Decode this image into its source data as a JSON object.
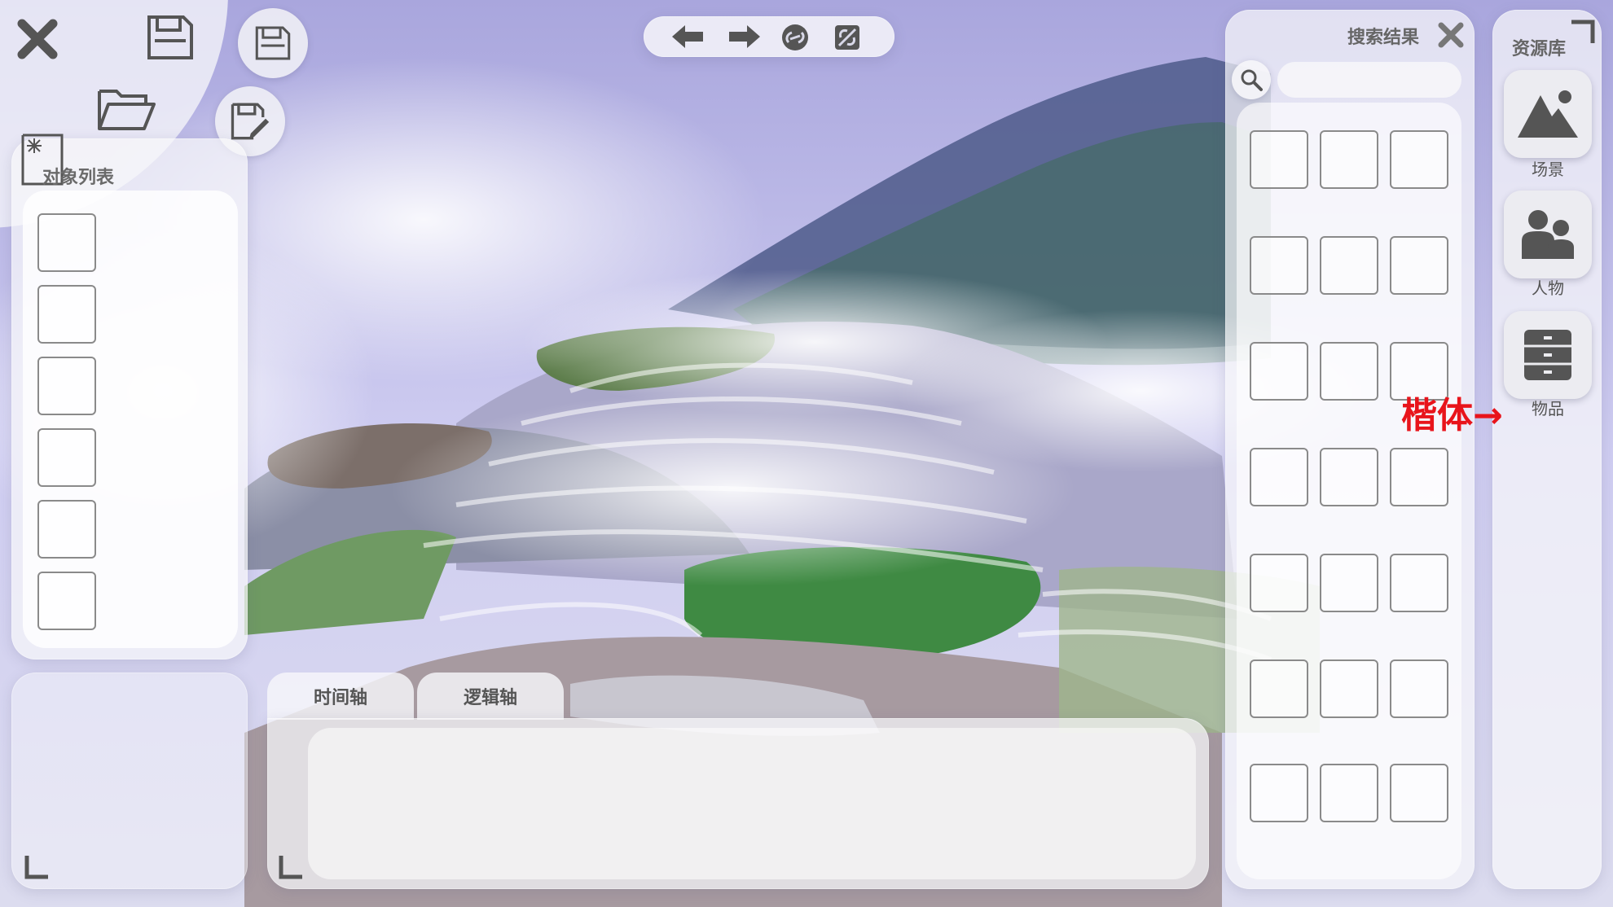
{
  "object_list": {
    "title": "对象列表"
  },
  "timeline_tabs": [
    {
      "label": "时间轴"
    },
    {
      "label": "逻辑轴"
    }
  ],
  "search_panel": {
    "title": "搜索结果",
    "query": ""
  },
  "library": {
    "title": "资源库",
    "categories": [
      {
        "label": "场景",
        "icon": "mountain-icon"
      },
      {
        "label": "人物",
        "icon": "people-icon"
      },
      {
        "label": "物品",
        "icon": "cabinet-icon"
      }
    ]
  },
  "annotation": {
    "text": "楷体→"
  },
  "colors": {
    "panel": "#f6f6fa",
    "icon_dark": "#555555",
    "annotation_red": "#e8141b"
  }
}
